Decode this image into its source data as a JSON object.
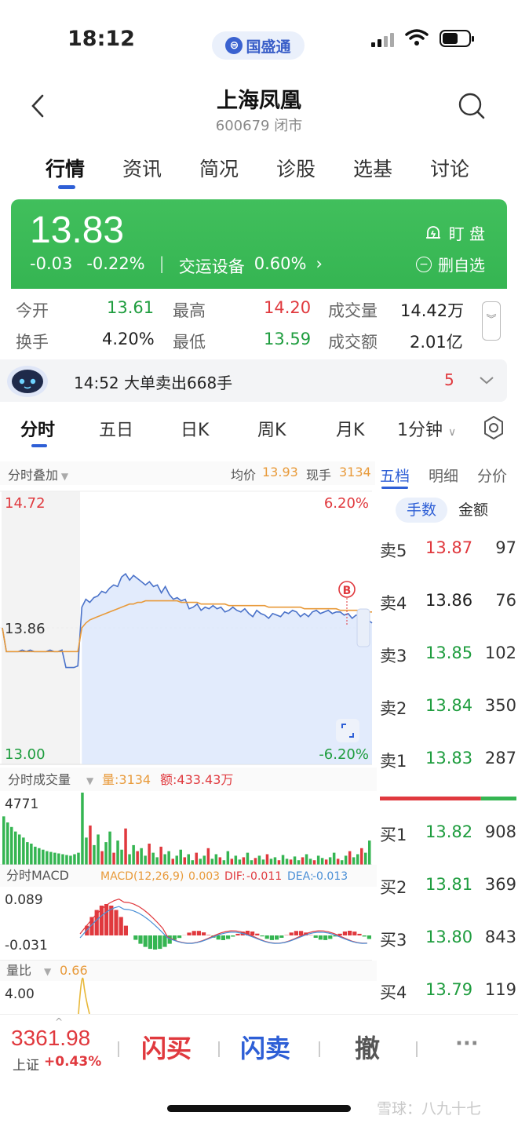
{
  "status": {
    "time": "18:12",
    "app_name": "国盛通"
  },
  "header": {
    "title": "上海凤凰",
    "subtitle": "600679 闭市"
  },
  "tabs": [
    "行情",
    "资讯",
    "简况",
    "诊股",
    "选基",
    "讨论"
  ],
  "quote": {
    "price": "13.83",
    "change": "-0.03",
    "change_pct": "-0.22%",
    "sector": "交运设备",
    "sector_pct": "0.60%",
    "watch_label": "盯 盘",
    "remove_label": "删自选"
  },
  "stats": {
    "open_label": "今开",
    "open": "13.61",
    "high_label": "最高",
    "high": "14.20",
    "volume_label": "成交量",
    "volume": "14.42万",
    "turnover_label": "换手",
    "turnover": "4.20%",
    "low_label": "最低",
    "low": "13.59",
    "amount_label": "成交额",
    "amount": "2.01亿"
  },
  "alert": {
    "text": "14:52 大单卖出668手",
    "count": "5"
  },
  "period_tabs": [
    "分时",
    "五日",
    "日K",
    "周K",
    "月K",
    "1分钟"
  ],
  "chart_header": {
    "overlay_label": "分时叠加",
    "avg_label": "均价",
    "avg": "13.93",
    "cur_label": "现手",
    "cur": "3134"
  },
  "chart_data": [
    {
      "type": "line",
      "name_text": "",
      "y_axis": {
        "top": "14.72",
        "mid": "13.86",
        "bottom": "13.00"
      },
      "pct_axis": {
        "top": "6.20%",
        "bottom": "-6.20%"
      },
      "ylim": [
        13.0,
        14.72
      ],
      "series": [
        {
          "name": "price",
          "color": "#4a72c9",
          "values": [
            13.86,
            13.71,
            13.71,
            13.71,
            13.71,
            13.72,
            13.71,
            13.72,
            13.71,
            13.71,
            13.71,
            13.71,
            13.72,
            13.71,
            13.71,
            13.72,
            13.61,
            13.61,
            13.61,
            13.62,
            13.99,
            14.04,
            14.02,
            14.05,
            14.06,
            14.09,
            14.08,
            14.11,
            14.13,
            14.12,
            14.18,
            14.2,
            14.16,
            14.19,
            14.17,
            14.15,
            14.13,
            14.15,
            14.12,
            14.13,
            14.08,
            14.12,
            14.07,
            14.04,
            14.05,
            14.03,
            14.04,
            13.98,
            13.99,
            14.01,
            13.97,
            13.99,
            13.98,
            14.0,
            13.98,
            13.99,
            13.96,
            13.97,
            13.99,
            13.97,
            13.96,
            13.98,
            13.95,
            13.93,
            13.97,
            13.95,
            13.94,
            13.92,
            13.95,
            13.94,
            13.93,
            13.96,
            13.95,
            13.97,
            13.96,
            13.93,
            13.95,
            13.93,
            13.96,
            13.97,
            13.95,
            13.96,
            13.97,
            13.95,
            13.96,
            13.96,
            13.94,
            13.95,
            13.92,
            13.94,
            13.93,
            13.9,
            13.91,
            13.89
          ]
        },
        {
          "name": "avg",
          "color": "#e89a3a",
          "values": [
            13.86,
            13.71,
            13.71,
            13.71,
            13.71,
            13.71,
            13.71,
            13.71,
            13.71,
            13.71,
            13.71,
            13.71,
            13.71,
            13.71,
            13.71,
            13.71,
            13.71,
            13.71,
            13.71,
            13.71,
            13.86,
            13.89,
            13.91,
            13.92,
            13.93,
            13.94,
            13.95,
            13.96,
            13.97,
            13.98,
            13.99,
            14.0,
            14.01,
            14.01,
            14.02,
            14.02,
            14.03,
            14.03,
            14.03,
            14.03,
            14.03,
            14.03,
            14.03,
            14.03,
            14.03,
            14.02,
            14.02,
            14.02,
            14.02,
            14.02,
            14.01,
            14.01,
            14.01,
            14.01,
            14.01,
            14.01,
            14.01,
            14.0,
            14.0,
            14.0,
            14.0,
            14.0,
            14.0,
            14.0,
            14.0,
            14.0,
            14.0,
            13.99,
            13.99,
            13.99,
            13.99,
            13.99,
            13.99,
            13.99,
            13.99,
            13.99,
            13.98,
            13.98,
            13.98,
            13.98,
            13.98,
            13.98,
            13.98,
            13.98,
            13.98,
            13.97,
            13.97,
            13.97,
            13.97,
            13.97,
            13.97,
            13.96,
            13.96,
            13.96
          ]
        }
      ]
    },
    {
      "type": "bar",
      "title": "分时成交量",
      "qty_label": "量:3134",
      "amt_label": "额:433.43万",
      "max_label": "4771",
      "ylim": [
        0,
        4771
      ],
      "values": [
        3200,
        2800,
        2500,
        2200,
        2000,
        1800,
        1500,
        1400,
        1200,
        1100,
        1000,
        900,
        850,
        800,
        750,
        700,
        650,
        600,
        700,
        800,
        4771,
        1800,
        2600,
        1300,
        2000,
        900,
        1500,
        2200,
        800,
        1600,
        1000,
        2400,
        700,
        1300,
        900,
        1100,
        600,
        1400,
        800,
        500,
        1200,
        700,
        900,
        400,
        600,
        1000,
        500,
        700,
        300,
        800,
        400,
        600,
        1100,
        400,
        700,
        500,
        300,
        900,
        400,
        600,
        350,
        500,
        800,
        300,
        450,
        600,
        350,
        700,
        400,
        500,
        300,
        650,
        400,
        350,
        550,
        300,
        500,
        700,
        400,
        300,
        600,
        450,
        350,
        500,
        800,
        400,
        300,
        600,
        900,
        500,
        700,
        1100,
        800,
        1600
      ],
      "colors": "mixed"
    },
    {
      "type": "bar",
      "title": "分时MACD",
      "params": "MACD(12,26,9)",
      "macd": "0.003",
      "dif_label": "DIF:",
      "dif": "-0.011",
      "dea_label": "DEA:",
      "dea": "-0.013",
      "top_label": "0.089",
      "bottom_label": "-0.031",
      "ylim": [
        -0.031,
        0.089
      ]
    },
    {
      "type": "line",
      "title": "量比",
      "value": "0.66",
      "top_label": "4.00"
    }
  ],
  "order_book": {
    "tabs": [
      "五档",
      "明细",
      "分价"
    ],
    "toggle": [
      "手数",
      "金额"
    ],
    "asks": [
      {
        "k": "卖5",
        "p": "13.87",
        "v": "97",
        "c": "red"
      },
      {
        "k": "卖4",
        "p": "13.86",
        "v": "76",
        "c": "blk"
      },
      {
        "k": "卖3",
        "p": "13.85",
        "v": "102",
        "c": "green"
      },
      {
        "k": "卖2",
        "p": "13.84",
        "v": "350",
        "c": "green"
      },
      {
        "k": "卖1",
        "p": "13.83",
        "v": "287",
        "c": "green"
      }
    ],
    "bids": [
      {
        "k": "买1",
        "p": "13.82",
        "v": "908",
        "c": "green"
      },
      {
        "k": "买2",
        "p": "13.81",
        "v": "369",
        "c": "green"
      },
      {
        "k": "买3",
        "p": "13.80",
        "v": "843",
        "c": "green"
      },
      {
        "k": "买4",
        "p": "13.79",
        "v": "119",
        "c": "green"
      }
    ],
    "buy_ratio": 0.74
  },
  "bottom": {
    "index_value": "3361.98",
    "index_label": "上证",
    "index_pct": "+0.43%",
    "flash_buy": "闪买",
    "flash_sell": "闪卖",
    "cancel": "撤",
    "more": "···"
  },
  "watermark": "雪球：八九十七",
  "colors": {
    "up": "#e0393e",
    "down": "#1f9d3f",
    "accent": "#2e5fd6",
    "green_card": "#38b955"
  }
}
